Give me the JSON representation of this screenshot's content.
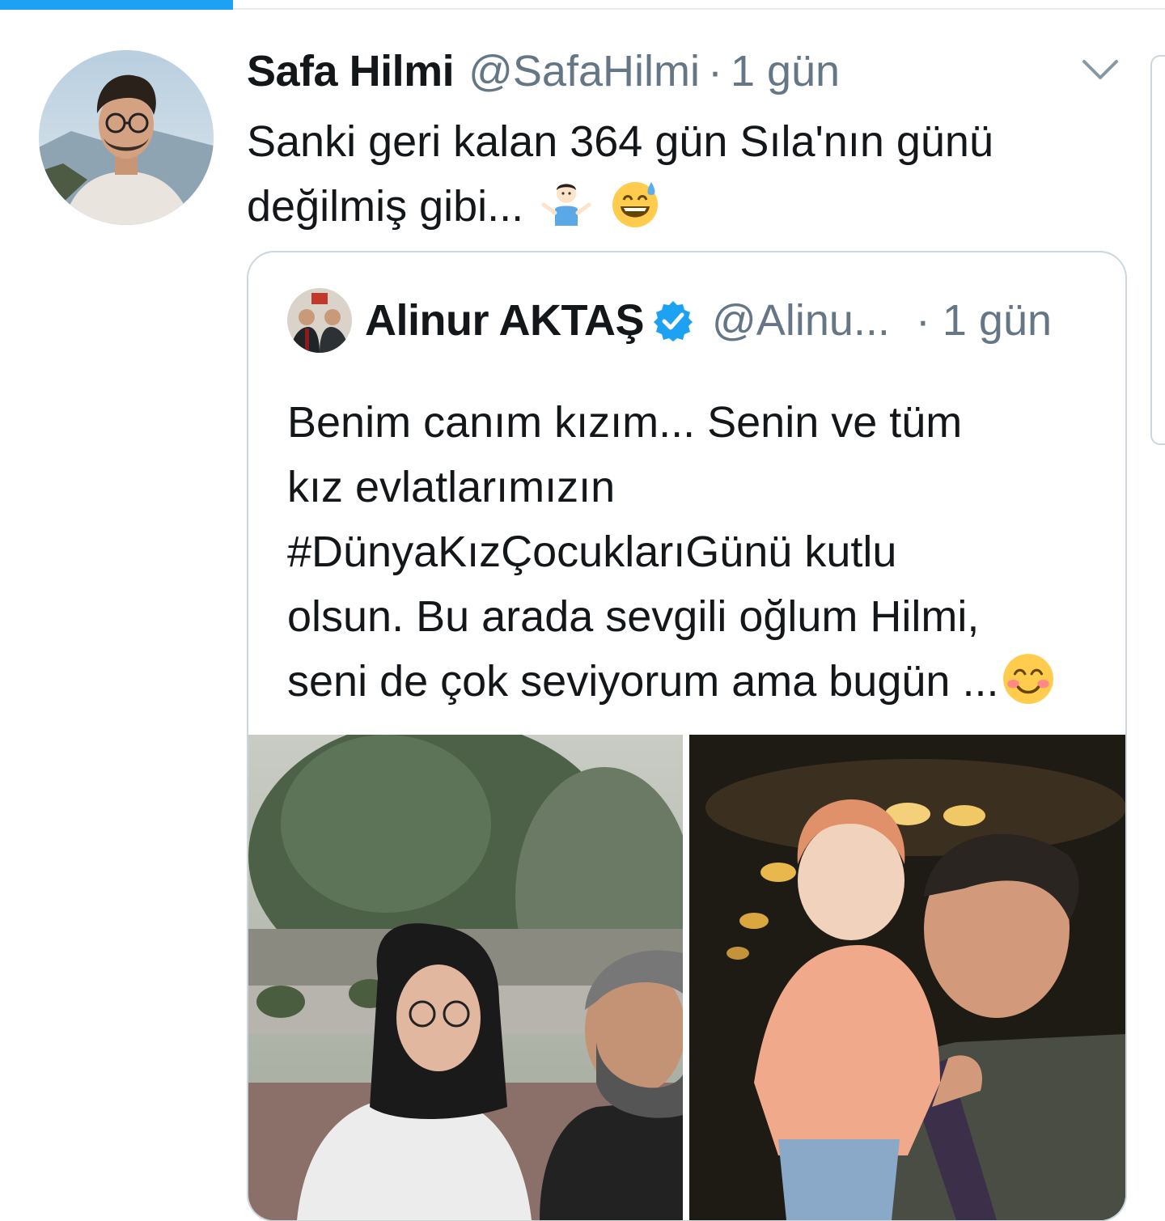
{
  "tweet": {
    "author_name": "Safa Hilmi",
    "author_handle": "@SafaHilmi",
    "separator": "·",
    "time": "1 gün",
    "text_line_1": "Sanki geri kalan 364 gün Sıla'nın günü",
    "text_line_2": "değilmiş gibi...",
    "emojis": [
      "person-shrugging-emoji",
      "grinning-sweat-emoji"
    ]
  },
  "quoted_tweet": {
    "author_name": "Alinur AKTAŞ",
    "verified": true,
    "author_handle": "@Alinu...",
    "separator": "·",
    "time": "1 gün",
    "lines": [
      "Benim canım kızım... Senin ve tüm",
      "kız evlatlarımızın",
      "#DünyaKızÇocuklarıGünü kutlu",
      "olsun. Bu arada sevgili oğlum Hilmi,",
      "seni de çok seviyorum ama bugün ..."
    ],
    "trailing_emoji": "smiling-blush-emoji",
    "media": [
      "photo-father-daughter-selfie",
      "photo-father-holding-baby"
    ]
  },
  "colors": {
    "accent": "#1da1f2",
    "text": "#14171a",
    "secondary": "#657786",
    "border": "#ccd6dd"
  }
}
